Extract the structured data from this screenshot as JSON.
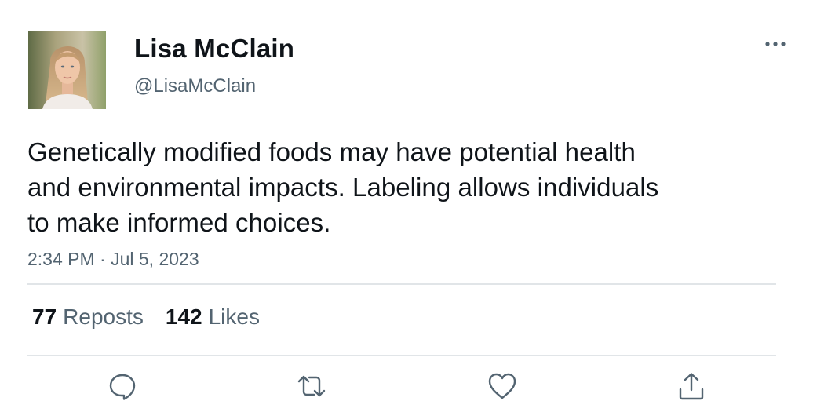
{
  "author": {
    "display_name": "Lisa McClain",
    "handle": "@LisaMcClain"
  },
  "tweet": {
    "text_lines": [
      "Genetically modified foods may have potential health",
      "and environmental impacts. Labeling allows individuals",
      "to make informed choices."
    ],
    "timestamp": "2:34 PM · Jul 5, 2023"
  },
  "stats": {
    "reposts_count": "77",
    "reposts_label": "Reposts",
    "likes_count": "142",
    "likes_label": "Likes"
  },
  "icons": {
    "more": "more-horizontal-icon",
    "reply": "reply-bubble-icon",
    "repost": "repost-arrows-icon",
    "like": "heart-icon",
    "share": "share-upload-icon"
  },
  "colors": {
    "text_primary": "#0f1419",
    "text_secondary": "#536471",
    "divider": "#e1e5e8",
    "icon": "#536471"
  }
}
